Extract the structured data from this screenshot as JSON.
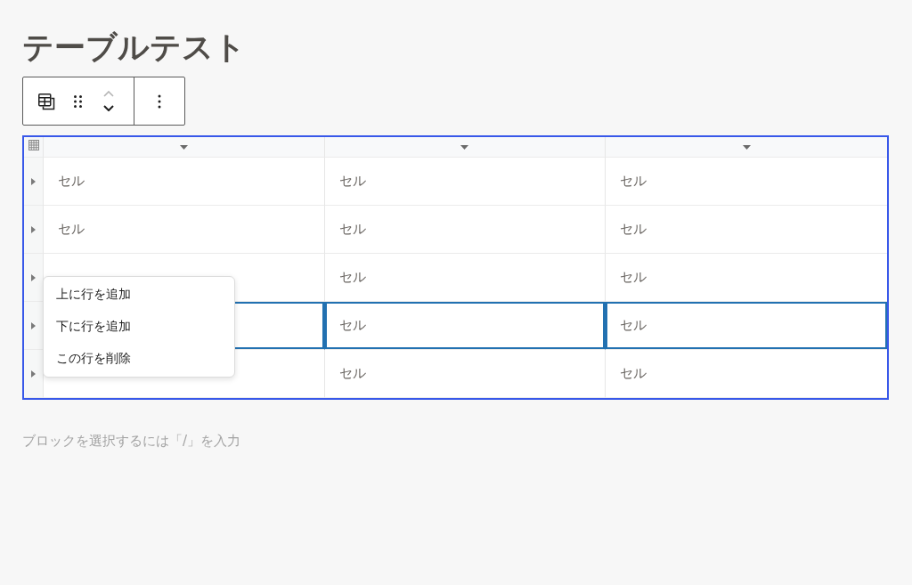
{
  "title": "テーブルテスト",
  "toolbar": {
    "move_up": {
      "disabled": true
    },
    "move_down": {
      "disabled": false
    }
  },
  "table": {
    "rows": [
      {
        "selected": false,
        "cells": [
          {
            "text": "セル"
          },
          {
            "text": "セル"
          },
          {
            "text": "セル"
          }
        ]
      },
      {
        "selected": false,
        "cells": [
          {
            "text": "セル"
          },
          {
            "text": "セル"
          },
          {
            "text": "セル"
          }
        ]
      },
      {
        "selected": false,
        "cells": [
          {},
          {
            "text": "セル"
          },
          {
            "text": "セル"
          }
        ]
      },
      {
        "selected": true,
        "cells": [
          {},
          {
            "text": "セル"
          },
          {
            "text": "セル"
          }
        ]
      },
      {
        "selected": false,
        "cells": [
          {},
          {
            "text": "セル"
          },
          {
            "text": "セル"
          }
        ]
      }
    ],
    "row_menu": {
      "items": [
        "上に行を追加",
        "下に行を追加",
        "この行を削除"
      ]
    }
  },
  "paragraph": {
    "placeholder": "ブロックを選択するには「/」を入力"
  }
}
